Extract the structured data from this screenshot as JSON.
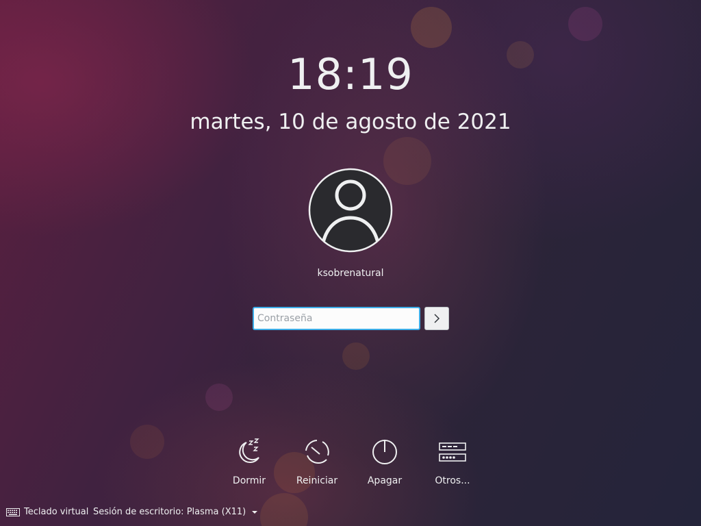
{
  "clock": {
    "time": "18:19",
    "date": "martes, 10 de agosto de 2021"
  },
  "user": {
    "name": "ksobrenatural",
    "avatar_icon": "user-avatar-icon"
  },
  "login": {
    "password_placeholder": "Contraseña",
    "submit_icon": "chevron-right-icon"
  },
  "actions": [
    {
      "label": "Dormir",
      "icon": "sleep-icon"
    },
    {
      "label": "Reiniciar",
      "icon": "restart-icon"
    },
    {
      "label": "Apagar",
      "icon": "power-icon"
    },
    {
      "label": "Otros...",
      "icon": "other-options-icon"
    }
  ],
  "footer": {
    "virtual_keyboard": "Teclado virtual",
    "session": "Sesión de escritorio: Plasma (X11)"
  },
  "colors": {
    "accent": "#3daee9",
    "text": "#eff0f1"
  }
}
